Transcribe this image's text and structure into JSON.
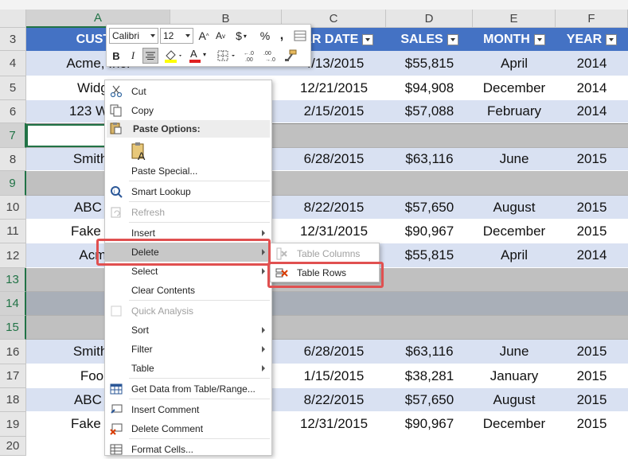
{
  "columns": [
    "A",
    "B",
    "C",
    "D",
    "E",
    "F"
  ],
  "header_row": {
    "row_number": "3",
    "cells": [
      "CUSTO",
      "",
      "DER DATE",
      "SALES",
      "MONTH",
      "YEAR"
    ]
  },
  "rows": [
    {
      "n": "4",
      "a": "Acme, Inc.",
      "b": "",
      "c": "4/13/2015",
      "d": "$55,815",
      "e": "April",
      "f": "2014"
    },
    {
      "n": "5",
      "a": "Widget",
      "b": "",
      "c": "12/21/2015",
      "d": "$94,908",
      "e": "December",
      "f": "2014"
    },
    {
      "n": "6",
      "a": "123 Ware",
      "b": "",
      "c": "2/15/2015",
      "d": "$57,088",
      "e": "February",
      "f": "2014"
    },
    {
      "n": "7",
      "a": "",
      "b": "",
      "c": "",
      "d": "",
      "e": "",
      "f": ""
    },
    {
      "n": "8",
      "a": "Smith ar",
      "b": "",
      "c": "6/28/2015",
      "d": "$63,116",
      "e": "June",
      "f": "2015"
    },
    {
      "n": "9",
      "a": "",
      "b": "",
      "c": "",
      "d": "",
      "e": "",
      "f": ""
    },
    {
      "n": "10",
      "a": "ABC Tel",
      "b": "",
      "c": "8/22/2015",
      "d": "$57,650",
      "e": "August",
      "f": "2015"
    },
    {
      "n": "11",
      "a": "Fake Bro",
      "b": "",
      "c": "12/31/2015",
      "d": "$90,967",
      "e": "December",
      "f": "2015"
    },
    {
      "n": "12",
      "a": "Acme,",
      "b": "",
      "c": "",
      "d": "$55,815",
      "e": "April",
      "f": "2014"
    },
    {
      "n": "13",
      "a": "",
      "b": "",
      "c": "",
      "d": "",
      "e": "",
      "f": ""
    },
    {
      "n": "14",
      "a": "",
      "b": "",
      "c": "",
      "d": "",
      "e": "",
      "f": ""
    },
    {
      "n": "15",
      "a": "",
      "b": "",
      "c": "",
      "d": "",
      "e": "",
      "f": ""
    },
    {
      "n": "16",
      "a": "Smith ar",
      "b": "",
      "c": "6/28/2015",
      "d": "$63,116",
      "e": "June",
      "f": "2015"
    },
    {
      "n": "17",
      "a": "Foo B",
      "b": "",
      "c": "1/15/2015",
      "d": "$38,281",
      "e": "January",
      "f": "2015"
    },
    {
      "n": "18",
      "a": "ABC Tel",
      "b": "",
      "c": "8/22/2015",
      "d": "$57,650",
      "e": "August",
      "f": "2015"
    },
    {
      "n": "19",
      "a": "Fake Bro",
      "b": "",
      "c": "12/31/2015",
      "d": "$90,967",
      "e": "December",
      "f": "2015"
    },
    {
      "n": "20",
      "a": "",
      "b": "",
      "c": "",
      "d": "",
      "e": "",
      "f": ""
    }
  ],
  "mini_toolbar": {
    "font_name": "Calibri",
    "font_size": "12",
    "grow_font": "A",
    "shrink_font": "A",
    "currency": "$",
    "percent": "%",
    "comma": ",",
    "bold": "B",
    "italic": "I",
    "font_color_letter": "A"
  },
  "context_menu": {
    "cut": "Cut",
    "copy": "Copy",
    "paste_options": "Paste Options:",
    "paste_special": "Paste Special...",
    "smart_lookup": "Smart Lookup",
    "refresh": "Refresh",
    "insert": "Insert",
    "delete": "Delete",
    "select": "Select",
    "clear_contents": "Clear Contents",
    "quick_analysis": "Quick Analysis",
    "sort": "Sort",
    "filter": "Filter",
    "table": "Table",
    "get_data": "Get Data from Table/Range...",
    "insert_comment": "Insert Comment",
    "delete_comment": "Delete Comment",
    "format_cells": "Format Cells..."
  },
  "delete_submenu": {
    "table_columns": "Table Columns",
    "table_rows": "Table Rows"
  },
  "colors": {
    "header_fill": "#4472c4",
    "band_fill": "#d9e1f2",
    "selected_fill": "#c0c0c0",
    "highlight_border": "#e05050",
    "excel_green": "#217346"
  }
}
